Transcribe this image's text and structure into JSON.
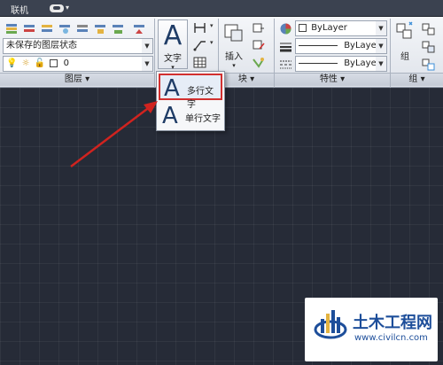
{
  "topbar": {
    "tab_label": "联机"
  },
  "ribbon": {
    "layers": {
      "state_combo": "未保存的图层状态",
      "layer_combo": "0",
      "footer": "图层 ▾"
    },
    "annotation": {
      "text_button": "文字"
    },
    "block": {
      "insert_button": "插入",
      "footer": "块 ▾"
    },
    "properties": {
      "color_combo": "ByLayer",
      "linetype_combo": "ByLayer",
      "lineweight_combo": "ByLayer",
      "footer": "特性 ▾"
    },
    "group": {
      "group_button": "组",
      "footer": "组 ▾"
    }
  },
  "dropdown": {
    "items": [
      {
        "label": "多行文字",
        "glyph": "A"
      },
      {
        "label": "单行文字",
        "glyph": "A"
      }
    ]
  },
  "watermark": {
    "title": "土木工程网",
    "url": "www.civilcn.com"
  },
  "colors": {
    "canvas": "#262b37",
    "highlight": "#d2302f",
    "arrow": "#d0231f",
    "brand": "#1d4e9a"
  }
}
